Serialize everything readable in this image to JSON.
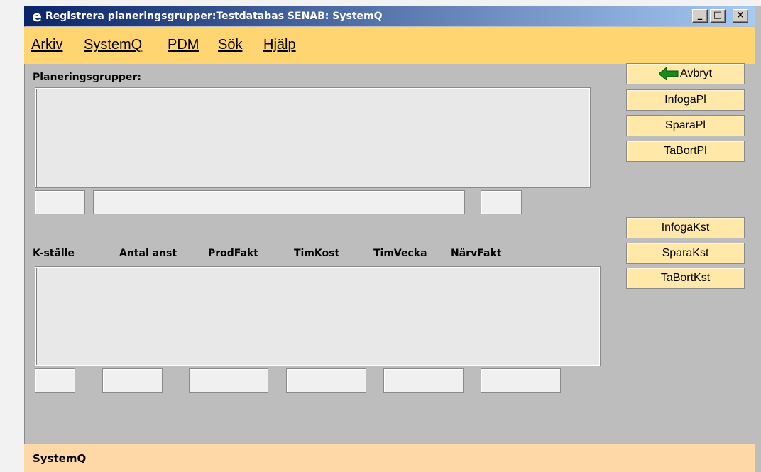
{
  "window": {
    "title": "Registrera planeringsgrupper:Testdatabas SENAB: SystemQ",
    "browser_icon": "e",
    "controls": {
      "minimize": "_",
      "maximize": "□",
      "close": "×"
    }
  },
  "menu": {
    "items": [
      {
        "label": "Arkiv"
      },
      {
        "label": "SystemQ"
      },
      {
        "label": "PDM"
      },
      {
        "label": "Sök"
      },
      {
        "label": "Hjälp"
      }
    ]
  },
  "planning": {
    "heading": "Planeringsgrupper:",
    "fields": {
      "code": "",
      "name": "",
      "extra": ""
    }
  },
  "buttons": {
    "avbryt": "Avbryt",
    "avbryt_icon": "arrow-left-icon",
    "infoga_pl": "InfogaPl",
    "spara_pl": "SparaPl",
    "tabort_pl": "TaBortPl",
    "infoga_kst": "InfogaKst",
    "spara_kst": "SparaKst",
    "tabort_kst": "TaBortKst"
  },
  "kst": {
    "columns": [
      "K-ställe",
      "Antal anst",
      "ProdFakt",
      "TimKost",
      "TimVecka",
      "NärvFakt"
    ],
    "fields": [
      "",
      "",
      "",
      "",
      "",
      ""
    ]
  },
  "status": {
    "text": "SystemQ"
  },
  "colors": {
    "title_start": "#0a246a",
    "title_end": "#a6caf0",
    "menubar": "#ffd571",
    "button": "#ffe8a8",
    "statusbar": "#ffd8a8",
    "window_bg": "#bdbdbd",
    "arrow": "#1a8a1a"
  }
}
